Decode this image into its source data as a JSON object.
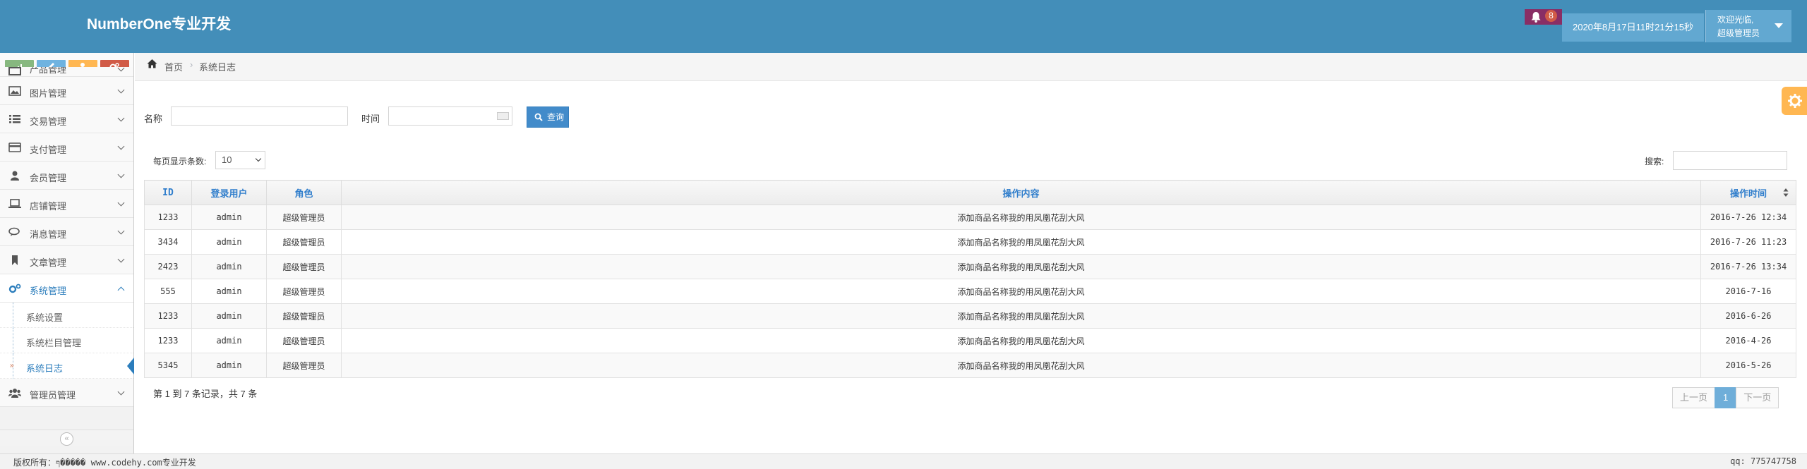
{
  "header": {
    "brand": "NumberOne专业开发",
    "notification_count": "8",
    "datetime": "2020年8月17日11时21分15秒",
    "welcome": "欢迎光临,",
    "role": "超级管理员"
  },
  "colors": {
    "header": "#438eb9",
    "shortcut_green": "#87b87f",
    "shortcut_blue": "#6fb3e0",
    "shortcut_orange": "#ffb752",
    "shortcut_red": "#d15b47",
    "primary": "#428bca",
    "active": "#2b7dbc"
  },
  "shortcuts": [
    {
      "icon": "signal-icon"
    },
    {
      "icon": "pencil-icon"
    },
    {
      "icon": "users-icon"
    },
    {
      "icon": "cogs-icon"
    }
  ],
  "sidebar": {
    "items": [
      {
        "label": "产品管理",
        "icon": "product-icon"
      },
      {
        "label": "图片管理",
        "icon": "picture-icon"
      },
      {
        "label": "交易管理",
        "icon": "list-icon"
      },
      {
        "label": "支付管理",
        "icon": "credit-card-icon"
      },
      {
        "label": "会员管理",
        "icon": "user-icon"
      },
      {
        "label": "店铺管理",
        "icon": "laptop-icon"
      },
      {
        "label": "消息管理",
        "icon": "comments-icon"
      },
      {
        "label": "文章管理",
        "icon": "bookmark-icon"
      },
      {
        "label": "系统管理",
        "icon": "cogs-icon"
      },
      {
        "label": "管理员管理",
        "icon": "group-icon"
      }
    ],
    "sub_items": [
      {
        "label": "系统设置"
      },
      {
        "label": "系统栏目管理"
      },
      {
        "label": "系统日志"
      }
    ],
    "collapse": "«"
  },
  "breadcrumb": {
    "home": "首页",
    "separator": "›",
    "current": "系统日志"
  },
  "search_form": {
    "name_label": "名称",
    "time_label": "时间",
    "query_button": "查询"
  },
  "table_controls": {
    "page_size_label": "每页显示条数:",
    "page_size_value": "10",
    "search_label": "搜索:"
  },
  "table": {
    "columns": [
      "ID",
      "登录用户",
      "角色",
      "操作内容",
      "操作时间"
    ],
    "rows": [
      {
        "id": "1233",
        "user": "admin",
        "role": "超级管理员",
        "content": "添加商品名称我的用凤凰花刮大风",
        "time": "2016-7-26 12:34"
      },
      {
        "id": "3434",
        "user": "admin",
        "role": "超级管理员",
        "content": "添加商品名称我的用凤凰花刮大风",
        "time": "2016-7-26 11:23"
      },
      {
        "id": "2423",
        "user": "admin",
        "role": "超级管理员",
        "content": "添加商品名称我的用凤凰花刮大风",
        "time": "2016-7-26 13:34"
      },
      {
        "id": "555",
        "user": "admin",
        "role": "超级管理员",
        "content": "添加商品名称我的用凤凰花刮大风",
        "time": "2016-7-16"
      },
      {
        "id": "1233",
        "user": "admin",
        "role": "超级管理员",
        "content": "添加商品名称我的用凤凰花刮大风",
        "time": "2016-6-26"
      },
      {
        "id": "1233",
        "user": "admin",
        "role": "超级管理员",
        "content": "添加商品名称我的用凤凰花刮大风",
        "time": "2016-4-26"
      },
      {
        "id": "5345",
        "user": "admin",
        "role": "超级管理员",
        "content": "添加商品名称我的用凤凰花刮大风",
        "time": "2016-5-26"
      }
    ],
    "info": "第 1 到 7 条记录，共 7 条"
  },
  "pagination": {
    "prev": "上一页",
    "current": "1",
    "next": "下一页"
  },
  "footer": {
    "copyright": "版权所有：׃�ףּ���� www.codehy.com专业开发",
    "qq": "qq: 775747758"
  }
}
